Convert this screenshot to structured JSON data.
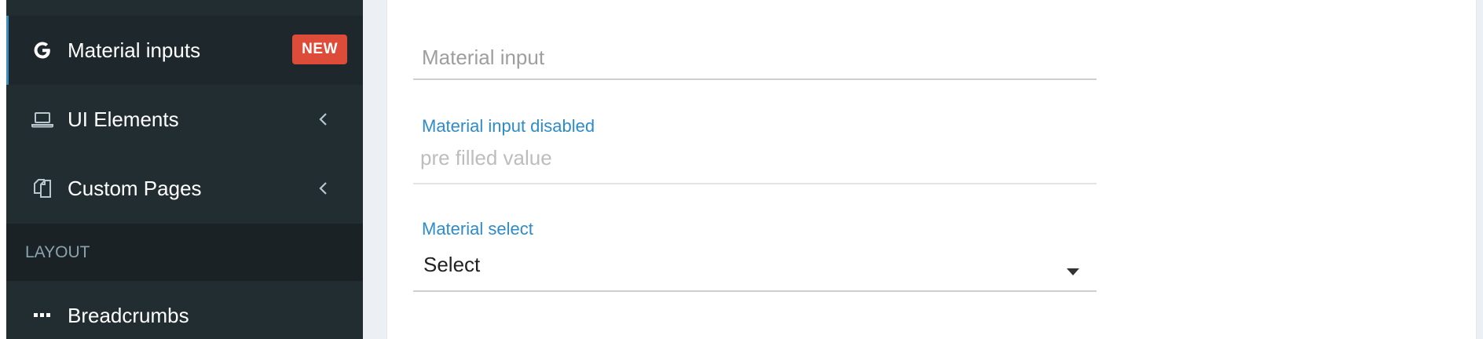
{
  "sidebar": {
    "items": [
      {
        "label": "Material inputs",
        "icon": "google-g-icon",
        "badge": "NEW",
        "active": true
      },
      {
        "label": "UI Elements",
        "icon": "laptop-icon",
        "expandable": true
      },
      {
        "label": "Custom Pages",
        "icon": "copy-files-icon",
        "expandable": true
      }
    ],
    "section_header": "LAYOUT",
    "layout_items": [
      {
        "label": "Breadcrumbs",
        "icon": "ellipsis-icon"
      }
    ]
  },
  "form": {
    "material_input": {
      "placeholder": "Material input"
    },
    "material_input_disabled": {
      "label": "Material input disabled",
      "value": "pre filled value"
    },
    "material_select": {
      "label": "Material select",
      "value": "Select"
    }
  },
  "colors": {
    "sidebar_bg": "#222d32",
    "active_bg": "#1e282c",
    "section_bg": "#1a2226",
    "badge_red": "#dd4b39",
    "label_blue": "#2e8bc9"
  }
}
